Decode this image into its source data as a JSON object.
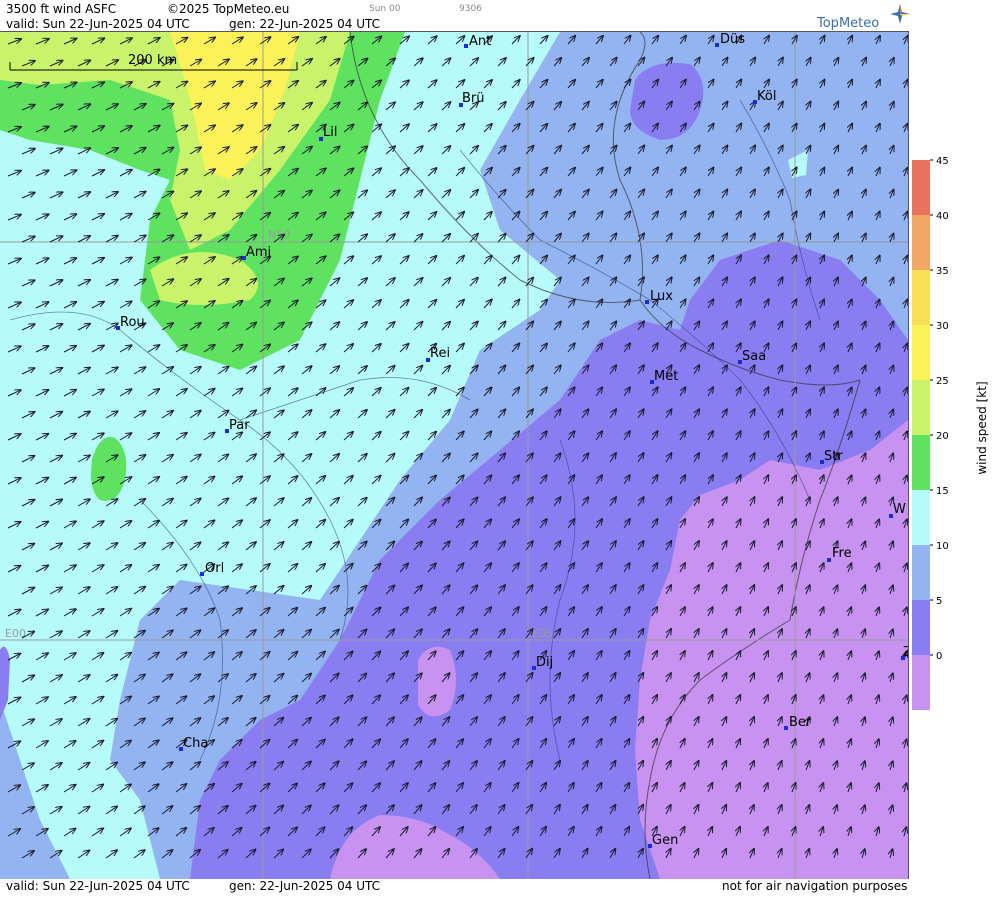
{
  "header": {
    "title": "3500 ft wind ASFC",
    "copyright": "©2025 TopMeteo.eu",
    "small_time": "Sun 00",
    "small_code": "9306",
    "valid": "valid:  Sun  22-Jun-2025  04 UTC",
    "gen": "gen: 22-Jun-2025 04 UTC"
  },
  "logo": {
    "text": "TopMeteo",
    "icon": "compass-star-icon"
  },
  "map": {
    "scale_bar": "200 km",
    "grid_labels": {
      "lat": "N50",
      "lon1": "E00",
      "lon2": "E05"
    },
    "cities": [
      "Ant",
      "Düs",
      "Brü",
      "Köl",
      "Lil",
      "Ami",
      "Rou",
      "Lux",
      "Rei",
      "Saa",
      "Met",
      "Par",
      "Str",
      "W",
      "Fre",
      "Orl",
      "Dij",
      "Ber",
      "Cha",
      "Gen",
      "Z"
    ]
  },
  "legend": {
    "axis_label": "wind speed [kt]",
    "ticks": [
      "45",
      "40",
      "35",
      "30",
      "25",
      "20",
      "15",
      "10",
      "5",
      "0"
    ],
    "colors": [
      "#e8735f",
      "#f3a766",
      "#f8e056",
      "#fbf25a",
      "#c9f36a",
      "#5ee260",
      "#b7fafa",
      "#93b4f0",
      "#8a7df2",
      "#c792f0"
    ]
  },
  "footer": {
    "valid": "valid:  Sun  22-Jun-2025  04 UTC",
    "gen": "gen: 22-Jun-2025 04 UTC",
    "disclaimer": "not for air navigation purposes"
  }
}
